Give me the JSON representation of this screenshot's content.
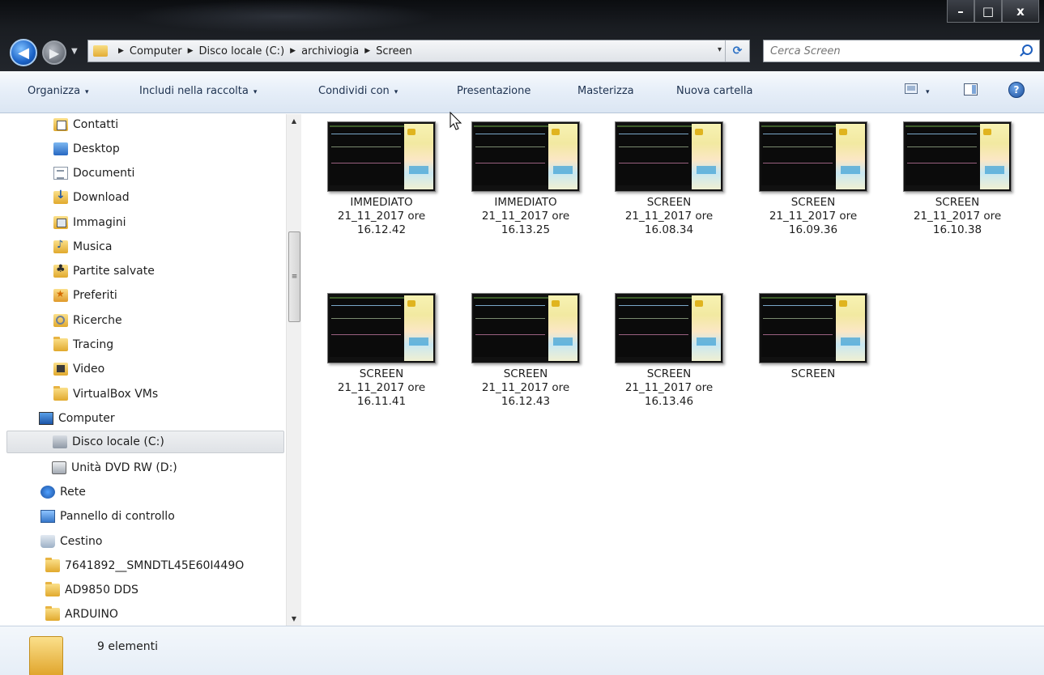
{
  "window": {
    "controls": [
      "–",
      "□",
      "x"
    ]
  },
  "address": {
    "crumbs": [
      "Computer",
      "Disco locale (C:)",
      "archiviogia",
      "Screen"
    ],
    "dropdown_arrow": "▾",
    "refresh_symbol": "⟳"
  },
  "search": {
    "placeholder": "Cerca Screen"
  },
  "toolbar": {
    "organize": "Organizza",
    "include_library": "Includi nella raccolta",
    "share": "Condividi con",
    "slideshow": "Presentazione",
    "burn": "Masterizza",
    "new_folder": "Nuova cartella",
    "caret": "▾",
    "help": "?"
  },
  "sidebar": {
    "items": [
      {
        "label": "Contatti",
        "icon": "contacts-icon"
      },
      {
        "label": "Desktop",
        "icon": "desktop-icon"
      },
      {
        "label": "Documenti",
        "icon": "documents-icon"
      },
      {
        "label": "Download",
        "icon": "download-icon"
      },
      {
        "label": "Immagini",
        "icon": "pictures-icon"
      },
      {
        "label": "Musica",
        "icon": "music-icon"
      },
      {
        "label": "Partite salvate",
        "icon": "saved-games-icon"
      },
      {
        "label": "Preferiti",
        "icon": "favorites-icon"
      },
      {
        "label": "Ricerche",
        "icon": "searches-icon"
      },
      {
        "label": "Tracing",
        "icon": "folder-icon"
      },
      {
        "label": "Video",
        "icon": "videos-icon"
      },
      {
        "label": "VirtualBox VMs",
        "icon": "folder-icon"
      },
      {
        "label": "Computer",
        "icon": "computer-icon"
      },
      {
        "label": "Disco locale (C:)",
        "icon": "drive-icon"
      },
      {
        "label": "Unità DVD RW (D:)",
        "icon": "dvd-drive-icon"
      },
      {
        "label": "Rete",
        "icon": "network-icon"
      },
      {
        "label": "Pannello di controllo",
        "icon": "control-panel-icon"
      },
      {
        "label": "Cestino",
        "icon": "recycle-bin-icon"
      },
      {
        "label": "7641892__SMNDTL45E60I449O",
        "icon": "folder-icon"
      },
      {
        "label": "AD9850 DDS",
        "icon": "folder-icon"
      },
      {
        "label": "ARDUINO",
        "icon": "folder-icon"
      }
    ],
    "selected": "Disco locale (C:)"
  },
  "scrollbar": {
    "up": "▲",
    "down": "▼",
    "grip": "≡"
  },
  "files": [
    {
      "line1": "IMMEDIATO",
      "line2": "21_11_2017 ore",
      "line3": "16.12.42"
    },
    {
      "line1": "IMMEDIATO",
      "line2": "21_11_2017 ore",
      "line3": "16.13.25"
    },
    {
      "line1": "SCREEN",
      "line2": "21_11_2017 ore",
      "line3": "16.08.34"
    },
    {
      "line1": "SCREEN",
      "line2": "21_11_2017 ore",
      "line3": "16.09.36"
    },
    {
      "line1": "SCREEN",
      "line2": "21_11_2017 ore",
      "line3": "16.10.38"
    },
    {
      "line1": "SCREEN",
      "line2": "21_11_2017 ore",
      "line3": "16.11.41"
    },
    {
      "line1": "SCREEN",
      "line2": "21_11_2017 ore",
      "line3": "16.12.43"
    },
    {
      "line1": "SCREEN",
      "line2": "21_11_2017 ore",
      "line3": "16.13.46"
    },
    {
      "line1": "SCREEN",
      "line2": "",
      "line3": ""
    }
  ],
  "status": {
    "count_text": "9 elementi"
  },
  "colors": {
    "toolbar_bg": "#dbe6f3",
    "selection": "#dfe2e6",
    "titlebar": "#1a1d22"
  }
}
